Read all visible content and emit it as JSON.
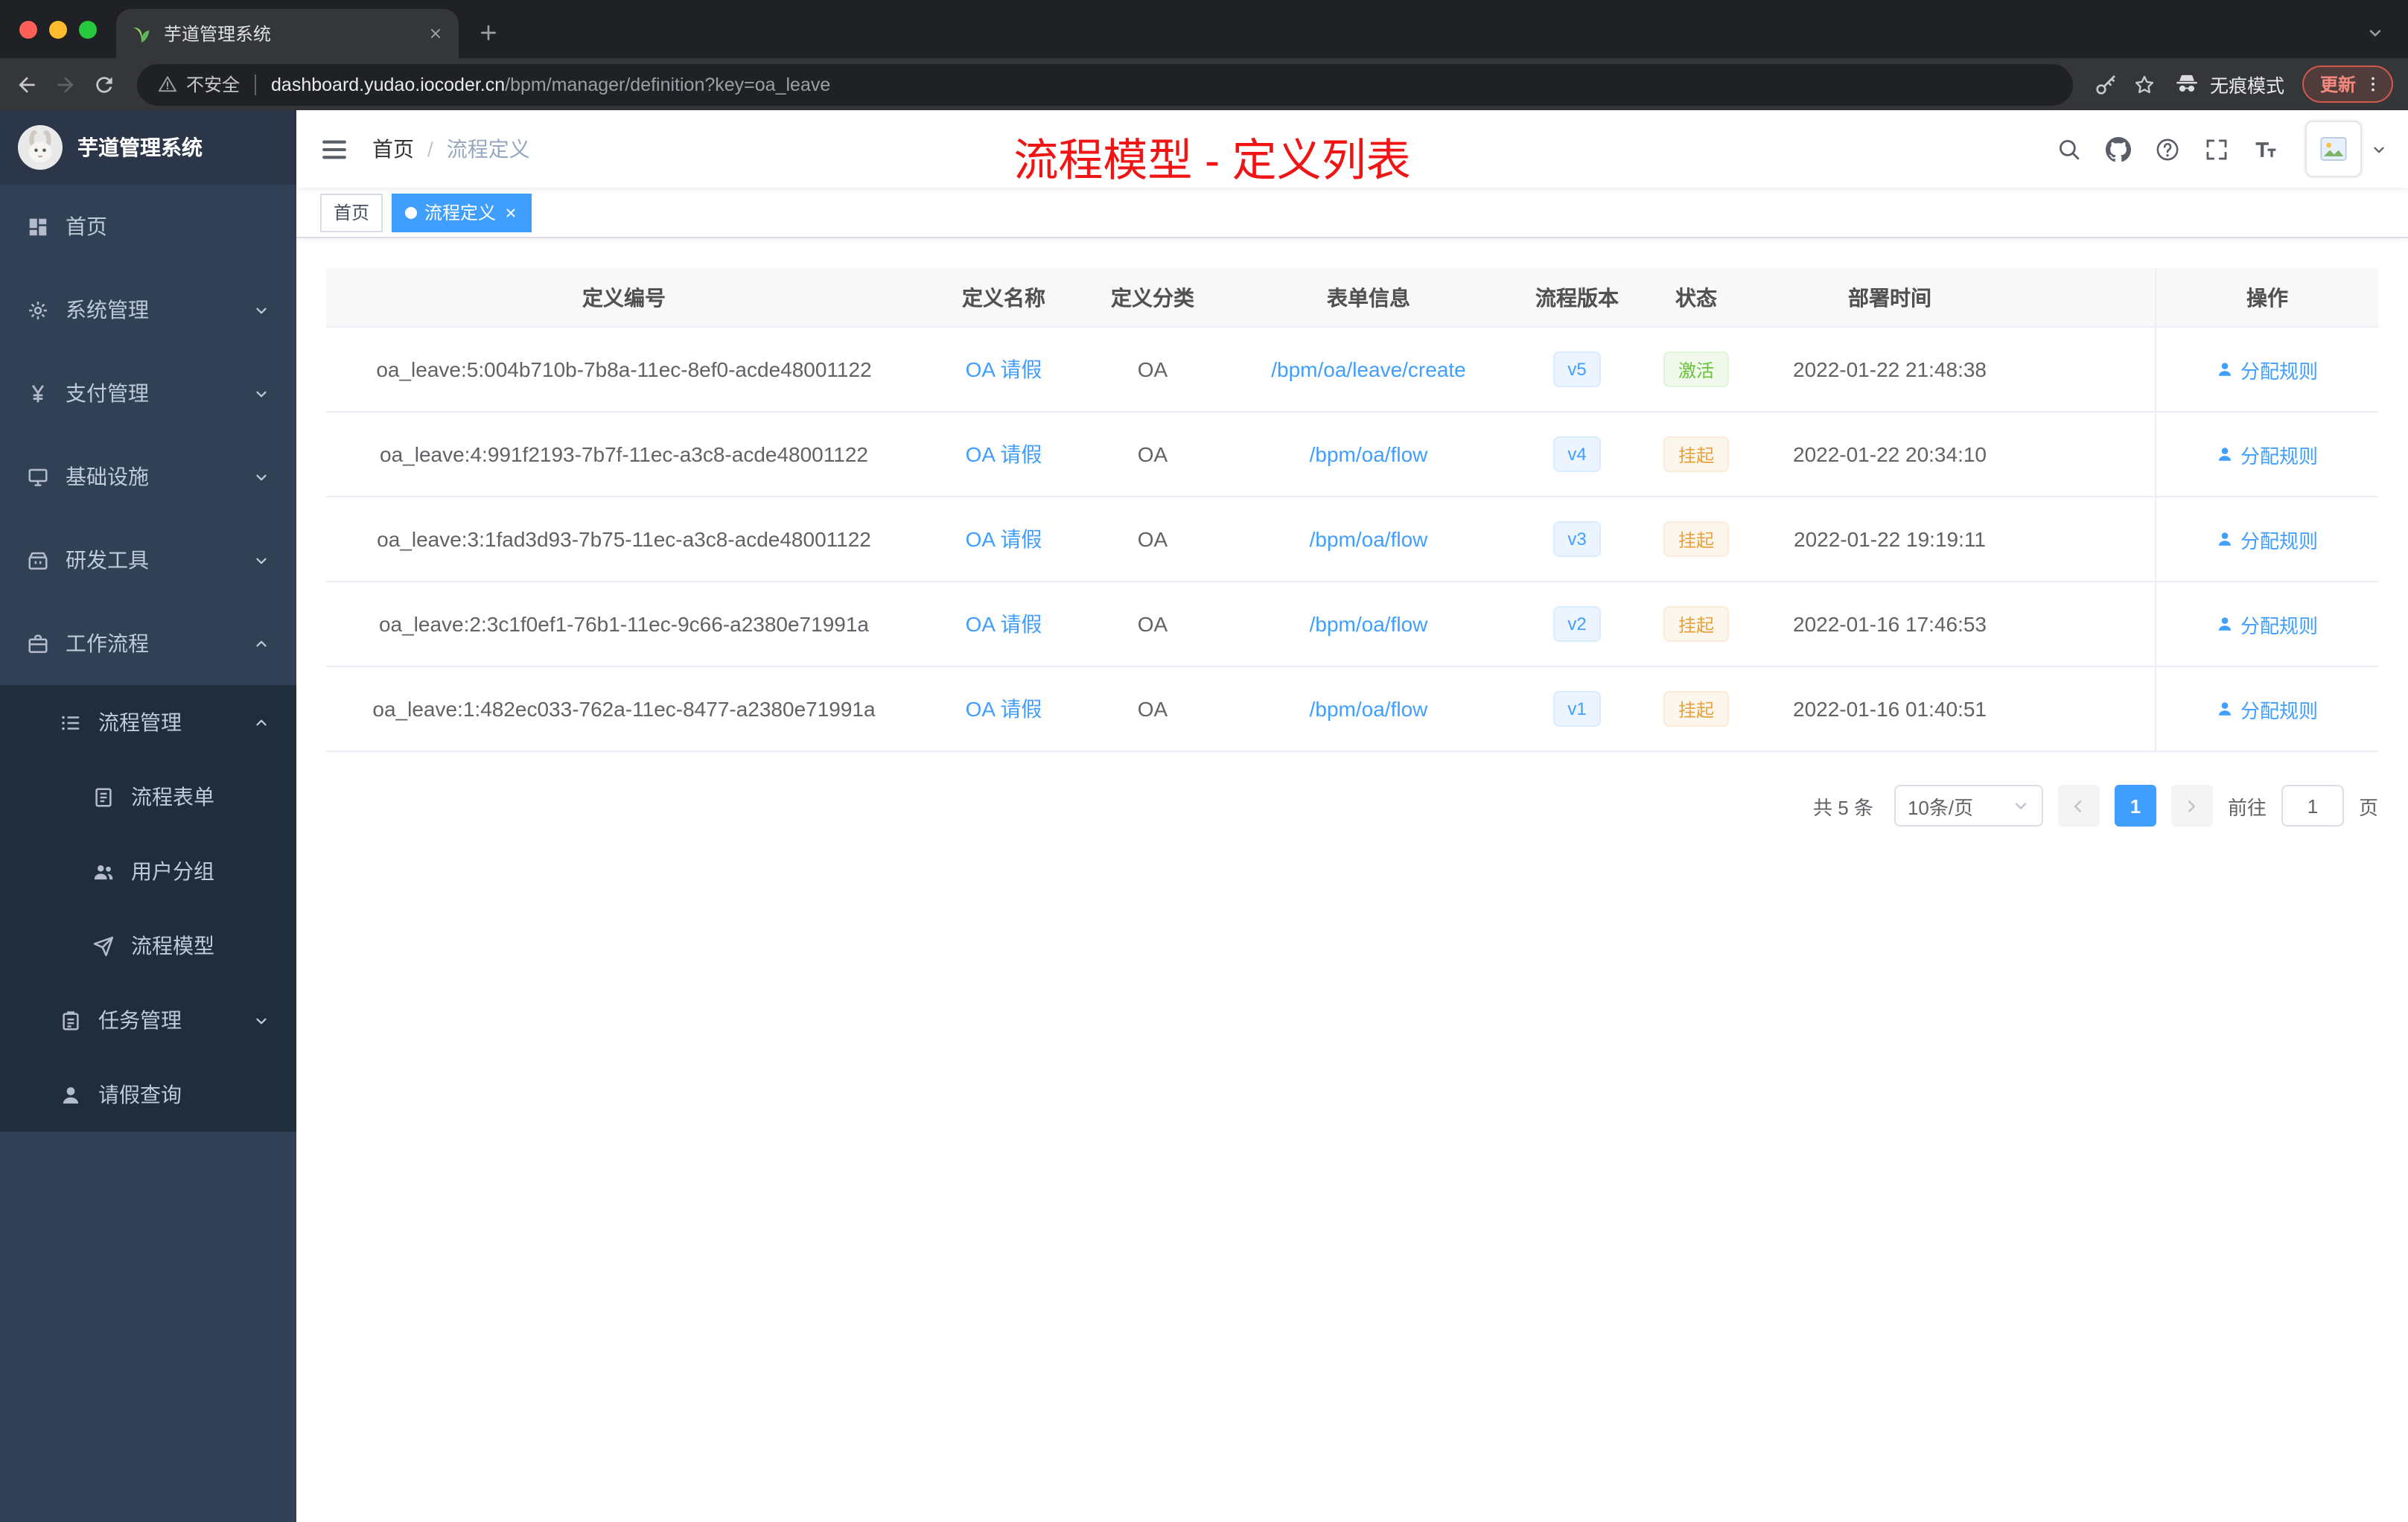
{
  "colors": {
    "accent": "#409eff",
    "sidebar_bg": "#304156",
    "submenu_bg": "#1f2d3d",
    "success": "#67c23a",
    "warning": "#e6a23c",
    "annotation_red": "#f11414"
  },
  "browser": {
    "tab_title": "芋道管理系统",
    "security_label": "不安全",
    "url_host": "dashboard.yudao.iocoder.cn",
    "url_path": "/bpm/manager/definition?key=oa_leave",
    "incognito_label": "无痕模式",
    "update_label": "更新"
  },
  "sidebar": {
    "logo_title": "芋道管理系统",
    "menu": [
      {
        "key": "home",
        "label": "首页",
        "icon": "dashboard-icon",
        "level": 1,
        "submenu": false,
        "chevron": ""
      },
      {
        "key": "system-management",
        "label": "系统管理",
        "icon": "gear-icon",
        "level": 1,
        "submenu": false,
        "chevron": "down"
      },
      {
        "key": "payment-management",
        "label": "支付管理",
        "icon": "yen-icon",
        "level": 1,
        "submenu": false,
        "chevron": "down"
      },
      {
        "key": "infrastructure",
        "label": "基础设施",
        "icon": "infra-icon",
        "level": 1,
        "submenu": false,
        "chevron": "down"
      },
      {
        "key": "dev-tools",
        "label": "研发工具",
        "icon": "toolbox-icon",
        "level": 1,
        "submenu": false,
        "chevron": "down"
      },
      {
        "key": "workflow",
        "label": "工作流程",
        "icon": "briefcase-icon",
        "level": 1,
        "submenu": false,
        "chevron": "up"
      },
      {
        "key": "process-management",
        "label": "流程管理",
        "icon": "list-icon",
        "level": 2,
        "submenu": true,
        "chevron": "up"
      },
      {
        "key": "process-form",
        "label": "流程表单",
        "icon": "form-icon",
        "level": 3,
        "submenu": true,
        "chevron": ""
      },
      {
        "key": "user-group",
        "label": "用户分组",
        "icon": "users-icon",
        "level": 3,
        "submenu": true,
        "chevron": ""
      },
      {
        "key": "process-model",
        "label": "流程模型",
        "icon": "send-icon",
        "level": 3,
        "submenu": true,
        "chevron": ""
      },
      {
        "key": "task-management",
        "label": "任务管理",
        "icon": "clipboard-icon",
        "level": 2,
        "submenu": true,
        "chevron": "down"
      },
      {
        "key": "leave-query",
        "label": "请假查询",
        "icon": "user-icon",
        "level": 2,
        "submenu": true,
        "chevron": ""
      }
    ]
  },
  "navbar": {
    "breadcrumb": [
      {
        "label": "首页"
      },
      {
        "label": "流程定义"
      }
    ],
    "annotation": "流程模型 - 定义列表"
  },
  "tags": [
    {
      "key": "home",
      "label": "首页",
      "active": false,
      "closable": false
    },
    {
      "key": "process-definition",
      "label": "流程定义",
      "active": true,
      "closable": true
    }
  ],
  "table": {
    "columns": [
      {
        "label": "定义编号",
        "key": "id"
      },
      {
        "label": "定义名称",
        "key": "name"
      },
      {
        "label": "定义分类",
        "key": "category"
      },
      {
        "label": "表单信息",
        "key": "form"
      },
      {
        "label": "流程版本",
        "key": "version"
      },
      {
        "label": "状态",
        "key": "status"
      },
      {
        "label": "部署时间",
        "key": "deploy-time"
      },
      {
        "label": "操作",
        "key": "actions"
      }
    ],
    "rows": [
      {
        "id": "oa_leave:5:004b710b-7b8a-11ec-8ef0-acde48001122",
        "name": "OA 请假",
        "category": "OA",
        "form": "/bpm/oa/leave/create",
        "version": "v5",
        "status": "激活",
        "statusType": "success",
        "deployTime": "2022-01-22 21:48:38",
        "action": "分配规则"
      },
      {
        "id": "oa_leave:4:991f2193-7b7f-11ec-a3c8-acde48001122",
        "name": "OA 请假",
        "category": "OA",
        "form": "/bpm/oa/flow",
        "version": "v4",
        "status": "挂起",
        "statusType": "warning",
        "deployTime": "2022-01-22 20:34:10",
        "action": "分配规则"
      },
      {
        "id": "oa_leave:3:1fad3d93-7b75-11ec-a3c8-acde48001122",
        "name": "OA 请假",
        "category": "OA",
        "form": "/bpm/oa/flow",
        "version": "v3",
        "status": "挂起",
        "statusType": "warning",
        "deployTime": "2022-01-22 19:19:11",
        "action": "分配规则"
      },
      {
        "id": "oa_leave:2:3c1f0ef1-76b1-11ec-9c66-a2380e71991a",
        "name": "OA 请假",
        "category": "OA",
        "form": "/bpm/oa/flow",
        "version": "v2",
        "status": "挂起",
        "statusType": "warning",
        "deployTime": "2022-01-16 17:46:53",
        "action": "分配规则"
      },
      {
        "id": "oa_leave:1:482ec033-762a-11ec-8477-a2380e71991a",
        "name": "OA 请假",
        "category": "OA",
        "form": "/bpm/oa/flow",
        "version": "v1",
        "status": "挂起",
        "statusType": "warning",
        "deployTime": "2022-01-16 01:40:51",
        "action": "分配规则"
      }
    ]
  },
  "pagination": {
    "total": "共 5 条",
    "page_size": "10条/页",
    "current_page": "1",
    "goto_prefix": "前往",
    "goto_value": "1",
    "goto_suffix": "页"
  }
}
